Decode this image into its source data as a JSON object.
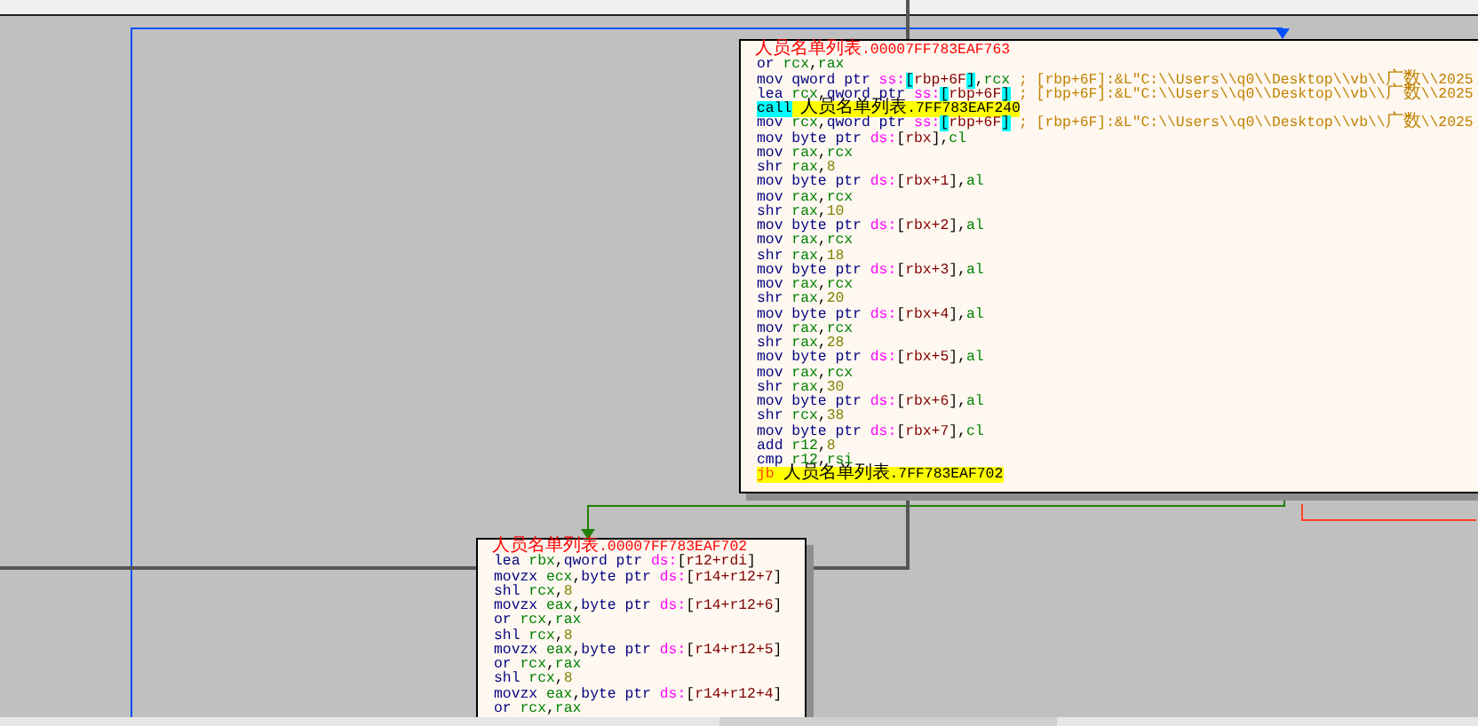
{
  "graph": {
    "blocks": [
      {
        "label": "人员名单列表.00007FF783EAF763",
        "lines": [
          [
            {
              "kind": "m",
              "text": "or "
            },
            {
              "kind": "r",
              "text": "rcx"
            },
            {
              "kind": "p",
              "text": ","
            },
            {
              "kind": "r",
              "text": "rax"
            }
          ],
          [
            {
              "kind": "m",
              "text": "mov "
            },
            {
              "kind": "z",
              "text": "qword ptr "
            },
            {
              "kind": "s",
              "text": "ss:"
            },
            {
              "kind": "b",
              "text": "["
            },
            {
              "kind": "a",
              "text": "rbp+6F"
            },
            {
              "kind": "b",
              "text": "]"
            },
            {
              "kind": "p",
              "text": ","
            },
            {
              "kind": "r",
              "text": "rcx "
            },
            {
              "kind": "c",
              "text": "; [rbp+6F]:&L\"C:\\\\Users\\\\q0\\\\Desktop\\\\vb\\\\广数\\\\2025"
            }
          ],
          [
            {
              "kind": "m",
              "text": "lea "
            },
            {
              "kind": "r",
              "text": "rcx"
            },
            {
              "kind": "p",
              "text": ","
            },
            {
              "kind": "z",
              "text": "qword ptr "
            },
            {
              "kind": "s",
              "text": "ss:"
            },
            {
              "kind": "b",
              "text": "["
            },
            {
              "kind": "a",
              "text": "rbp+6F"
            },
            {
              "kind": "b",
              "text": "]"
            },
            {
              "kind": "c",
              "text": " ; [rbp+6F]:&L\"C:\\\\Users\\\\q0\\\\Desktop\\\\vb\\\\广数\\\\2025"
            }
          ],
          [
            {
              "kind": "k",
              "text": "call"
            },
            {
              "kind": "t",
              "text": " 人员名单列表.7FF783EAF240"
            }
          ],
          [
            {
              "kind": "m",
              "text": "mov "
            },
            {
              "kind": "r",
              "text": "rcx"
            },
            {
              "kind": "p",
              "text": ","
            },
            {
              "kind": "z",
              "text": "qword ptr "
            },
            {
              "kind": "s",
              "text": "ss:"
            },
            {
              "kind": "b",
              "text": "["
            },
            {
              "kind": "a",
              "text": "rbp+6F"
            },
            {
              "kind": "b",
              "text": "]"
            },
            {
              "kind": "c",
              "text": " ; [rbp+6F]:&L\"C:\\\\Users\\\\q0\\\\Desktop\\\\vb\\\\广数\\\\2025"
            }
          ],
          [
            {
              "kind": "m",
              "text": "mov "
            },
            {
              "kind": "z",
              "text": "byte ptr "
            },
            {
              "kind": "s",
              "text": "ds:"
            },
            {
              "kind": "p",
              "text": "["
            },
            {
              "kind": "a",
              "text": "rbx"
            },
            {
              "kind": "p",
              "text": "],"
            },
            {
              "kind": "r",
              "text": "cl"
            }
          ],
          [
            {
              "kind": "m",
              "text": "mov "
            },
            {
              "kind": "r",
              "text": "rax"
            },
            {
              "kind": "p",
              "text": ","
            },
            {
              "kind": "r",
              "text": "rcx"
            }
          ],
          [
            {
              "kind": "m",
              "text": "shr "
            },
            {
              "kind": "r",
              "text": "rax"
            },
            {
              "kind": "p",
              "text": ","
            },
            {
              "kind": "n",
              "text": "8"
            }
          ],
          [
            {
              "kind": "m",
              "text": "mov "
            },
            {
              "kind": "z",
              "text": "byte ptr "
            },
            {
              "kind": "s",
              "text": "ds:"
            },
            {
              "kind": "p",
              "text": "["
            },
            {
              "kind": "a",
              "text": "rbx+1"
            },
            {
              "kind": "p",
              "text": "],"
            },
            {
              "kind": "r",
              "text": "al"
            }
          ],
          [
            {
              "kind": "m",
              "text": "mov "
            },
            {
              "kind": "r",
              "text": "rax"
            },
            {
              "kind": "p",
              "text": ","
            },
            {
              "kind": "r",
              "text": "rcx"
            }
          ],
          [
            {
              "kind": "m",
              "text": "shr "
            },
            {
              "kind": "r",
              "text": "rax"
            },
            {
              "kind": "p",
              "text": ","
            },
            {
              "kind": "n",
              "text": "10"
            }
          ],
          [
            {
              "kind": "m",
              "text": "mov "
            },
            {
              "kind": "z",
              "text": "byte ptr "
            },
            {
              "kind": "s",
              "text": "ds:"
            },
            {
              "kind": "p",
              "text": "["
            },
            {
              "kind": "a",
              "text": "rbx+2"
            },
            {
              "kind": "p",
              "text": "],"
            },
            {
              "kind": "r",
              "text": "al"
            }
          ],
          [
            {
              "kind": "m",
              "text": "mov "
            },
            {
              "kind": "r",
              "text": "rax"
            },
            {
              "kind": "p",
              "text": ","
            },
            {
              "kind": "r",
              "text": "rcx"
            }
          ],
          [
            {
              "kind": "m",
              "text": "shr "
            },
            {
              "kind": "r",
              "text": "rax"
            },
            {
              "kind": "p",
              "text": ","
            },
            {
              "kind": "n",
              "text": "18"
            }
          ],
          [
            {
              "kind": "m",
              "text": "mov "
            },
            {
              "kind": "z",
              "text": "byte ptr "
            },
            {
              "kind": "s",
              "text": "ds:"
            },
            {
              "kind": "p",
              "text": "["
            },
            {
              "kind": "a",
              "text": "rbx+3"
            },
            {
              "kind": "p",
              "text": "],"
            },
            {
              "kind": "r",
              "text": "al"
            }
          ],
          [
            {
              "kind": "m",
              "text": "mov "
            },
            {
              "kind": "r",
              "text": "rax"
            },
            {
              "kind": "p",
              "text": ","
            },
            {
              "kind": "r",
              "text": "rcx"
            }
          ],
          [
            {
              "kind": "m",
              "text": "shr "
            },
            {
              "kind": "r",
              "text": "rax"
            },
            {
              "kind": "p",
              "text": ","
            },
            {
              "kind": "n",
              "text": "20"
            }
          ],
          [
            {
              "kind": "m",
              "text": "mov "
            },
            {
              "kind": "z",
              "text": "byte ptr "
            },
            {
              "kind": "s",
              "text": "ds:"
            },
            {
              "kind": "p",
              "text": "["
            },
            {
              "kind": "a",
              "text": "rbx+4"
            },
            {
              "kind": "p",
              "text": "],"
            },
            {
              "kind": "r",
              "text": "al"
            }
          ],
          [
            {
              "kind": "m",
              "text": "mov "
            },
            {
              "kind": "r",
              "text": "rax"
            },
            {
              "kind": "p",
              "text": ","
            },
            {
              "kind": "r",
              "text": "rcx"
            }
          ],
          [
            {
              "kind": "m",
              "text": "shr "
            },
            {
              "kind": "r",
              "text": "rax"
            },
            {
              "kind": "p",
              "text": ","
            },
            {
              "kind": "n",
              "text": "28"
            }
          ],
          [
            {
              "kind": "m",
              "text": "mov "
            },
            {
              "kind": "z",
              "text": "byte ptr "
            },
            {
              "kind": "s",
              "text": "ds:"
            },
            {
              "kind": "p",
              "text": "["
            },
            {
              "kind": "a",
              "text": "rbx+5"
            },
            {
              "kind": "p",
              "text": "],"
            },
            {
              "kind": "r",
              "text": "al"
            }
          ],
          [
            {
              "kind": "m",
              "text": "mov "
            },
            {
              "kind": "r",
              "text": "rax"
            },
            {
              "kind": "p",
              "text": ","
            },
            {
              "kind": "r",
              "text": "rcx"
            }
          ],
          [
            {
              "kind": "m",
              "text": "shr "
            },
            {
              "kind": "r",
              "text": "rax"
            },
            {
              "kind": "p",
              "text": ","
            },
            {
              "kind": "n",
              "text": "30"
            }
          ],
          [
            {
              "kind": "m",
              "text": "mov "
            },
            {
              "kind": "z",
              "text": "byte ptr "
            },
            {
              "kind": "s",
              "text": "ds:"
            },
            {
              "kind": "p",
              "text": "["
            },
            {
              "kind": "a",
              "text": "rbx+6"
            },
            {
              "kind": "p",
              "text": "],"
            },
            {
              "kind": "r",
              "text": "al"
            }
          ],
          [
            {
              "kind": "m",
              "text": "shr "
            },
            {
              "kind": "r",
              "text": "rcx"
            },
            {
              "kind": "p",
              "text": ","
            },
            {
              "kind": "n",
              "text": "38"
            }
          ],
          [
            {
              "kind": "m",
              "text": "mov "
            },
            {
              "kind": "z",
              "text": "byte ptr "
            },
            {
              "kind": "s",
              "text": "ds:"
            },
            {
              "kind": "p",
              "text": "["
            },
            {
              "kind": "a",
              "text": "rbx+7"
            },
            {
              "kind": "p",
              "text": "],"
            },
            {
              "kind": "r",
              "text": "cl"
            }
          ],
          [
            {
              "kind": "m",
              "text": "add "
            },
            {
              "kind": "r",
              "text": "r12"
            },
            {
              "kind": "p",
              "text": ","
            },
            {
              "kind": "n",
              "text": "8"
            }
          ],
          [
            {
              "kind": "m",
              "text": "cmp "
            },
            {
              "kind": "r",
              "text": "r12"
            },
            {
              "kind": "p",
              "text": ","
            },
            {
              "kind": "r",
              "text": "rsi"
            }
          ],
          [
            {
              "kind": "j",
              "text": "jb"
            },
            {
              "kind": "t",
              "text": " 人员名单列表.7FF783EAF702"
            }
          ]
        ]
      },
      {
        "label": "人员名单列表.00007FF783EAF702",
        "lines": [
          [
            {
              "kind": "m",
              "text": "lea "
            },
            {
              "kind": "r",
              "text": "rbx"
            },
            {
              "kind": "p",
              "text": ","
            },
            {
              "kind": "z",
              "text": "qword ptr "
            },
            {
              "kind": "s",
              "text": "ds:"
            },
            {
              "kind": "p",
              "text": "["
            },
            {
              "kind": "a",
              "text": "r12+rdi"
            },
            {
              "kind": "p",
              "text": "]"
            }
          ],
          [
            {
              "kind": "m",
              "text": "movzx "
            },
            {
              "kind": "r",
              "text": "ecx"
            },
            {
              "kind": "p",
              "text": ","
            },
            {
              "kind": "z",
              "text": "byte ptr "
            },
            {
              "kind": "s",
              "text": "ds:"
            },
            {
              "kind": "p",
              "text": "["
            },
            {
              "kind": "a",
              "text": "r14+r12+7"
            },
            {
              "kind": "p",
              "text": "]"
            }
          ],
          [
            {
              "kind": "m",
              "text": "shl "
            },
            {
              "kind": "r",
              "text": "rcx"
            },
            {
              "kind": "p",
              "text": ","
            },
            {
              "kind": "n",
              "text": "8"
            }
          ],
          [
            {
              "kind": "m",
              "text": "movzx "
            },
            {
              "kind": "r",
              "text": "eax"
            },
            {
              "kind": "p",
              "text": ","
            },
            {
              "kind": "z",
              "text": "byte ptr "
            },
            {
              "kind": "s",
              "text": "ds:"
            },
            {
              "kind": "p",
              "text": "["
            },
            {
              "kind": "a",
              "text": "r14+r12+6"
            },
            {
              "kind": "p",
              "text": "]"
            }
          ],
          [
            {
              "kind": "m",
              "text": "or "
            },
            {
              "kind": "r",
              "text": "rcx"
            },
            {
              "kind": "p",
              "text": ","
            },
            {
              "kind": "r",
              "text": "rax"
            }
          ],
          [
            {
              "kind": "m",
              "text": "shl "
            },
            {
              "kind": "r",
              "text": "rcx"
            },
            {
              "kind": "p",
              "text": ","
            },
            {
              "kind": "n",
              "text": "8"
            }
          ],
          [
            {
              "kind": "m",
              "text": "movzx "
            },
            {
              "kind": "r",
              "text": "eax"
            },
            {
              "kind": "p",
              "text": ","
            },
            {
              "kind": "z",
              "text": "byte ptr "
            },
            {
              "kind": "s",
              "text": "ds:"
            },
            {
              "kind": "p",
              "text": "["
            },
            {
              "kind": "a",
              "text": "r14+r12+5"
            },
            {
              "kind": "p",
              "text": "]"
            }
          ],
          [
            {
              "kind": "m",
              "text": "or "
            },
            {
              "kind": "r",
              "text": "rcx"
            },
            {
              "kind": "p",
              "text": ","
            },
            {
              "kind": "r",
              "text": "rax"
            }
          ],
          [
            {
              "kind": "m",
              "text": "shl "
            },
            {
              "kind": "r",
              "text": "rcx"
            },
            {
              "kind": "p",
              "text": ","
            },
            {
              "kind": "n",
              "text": "8"
            }
          ],
          [
            {
              "kind": "m",
              "text": "movzx "
            },
            {
              "kind": "r",
              "text": "eax"
            },
            {
              "kind": "p",
              "text": ","
            },
            {
              "kind": "z",
              "text": "byte ptr "
            },
            {
              "kind": "s",
              "text": "ds:"
            },
            {
              "kind": "p",
              "text": "["
            },
            {
              "kind": "a",
              "text": "r14+r12+4"
            },
            {
              "kind": "p",
              "text": "]"
            }
          ],
          [
            {
              "kind": "m",
              "text": "or "
            },
            {
              "kind": "r",
              "text": "rcx"
            },
            {
              "kind": "p",
              "text": ","
            },
            {
              "kind": "r",
              "text": "rax"
            }
          ]
        ]
      }
    ],
    "edges": [
      {
        "kind": "jump"
      },
      {
        "kind": "taken"
      },
      {
        "kind": "not_taken"
      }
    ]
  }
}
